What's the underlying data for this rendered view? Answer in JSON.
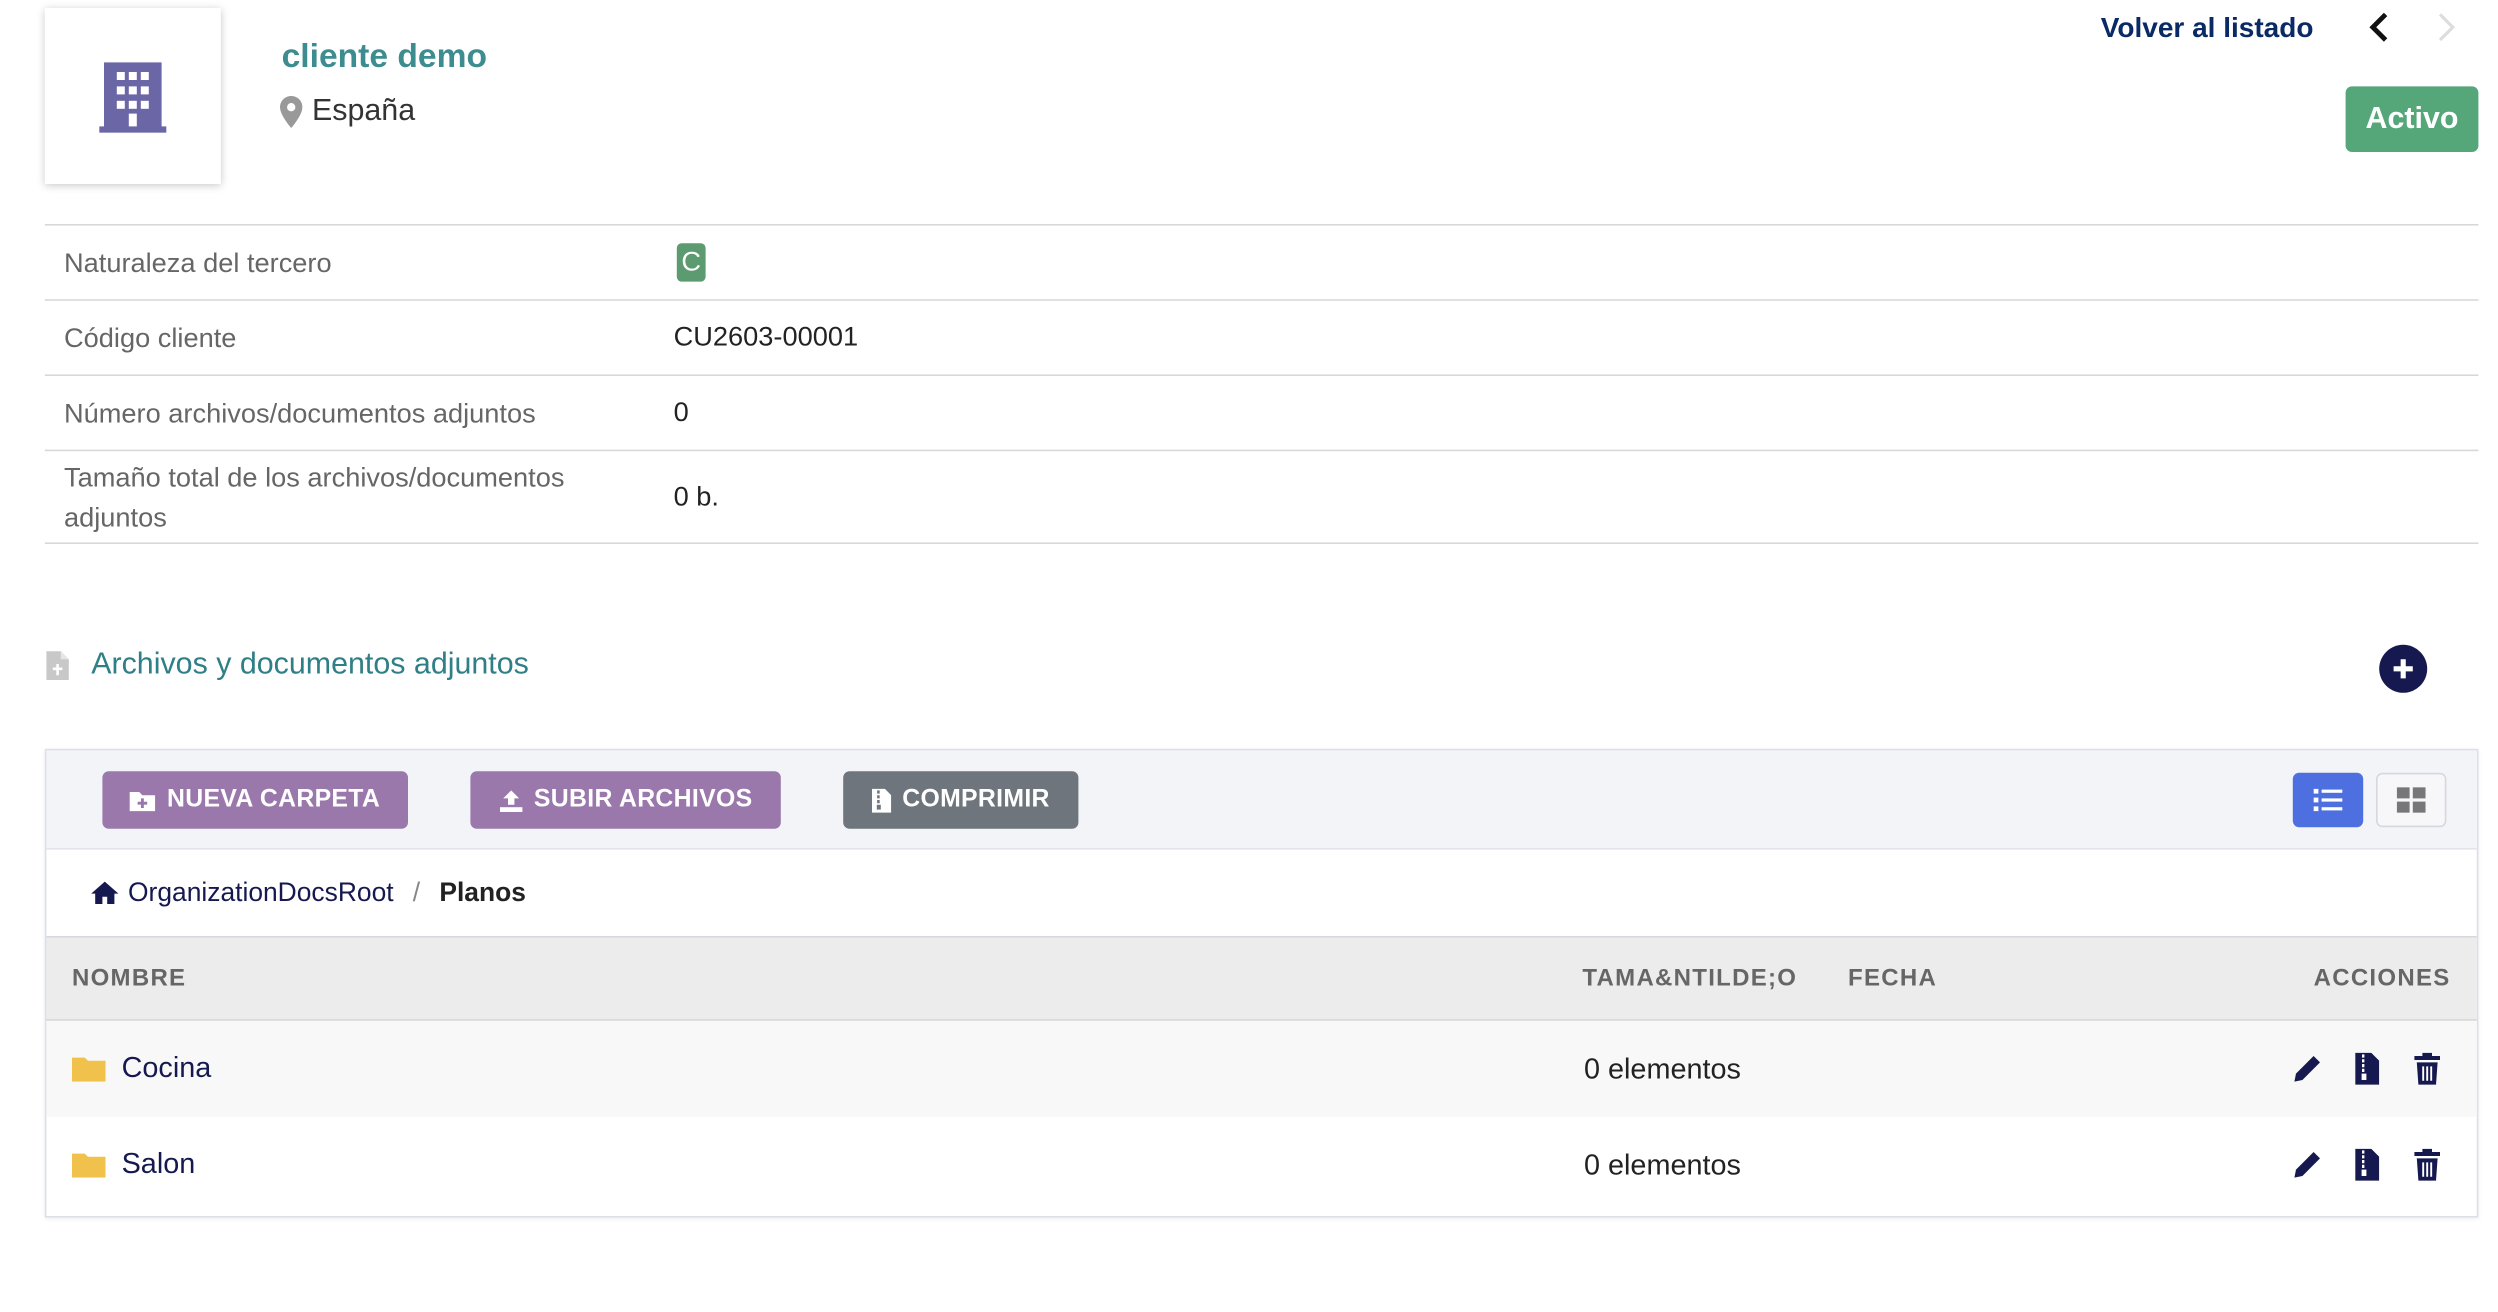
{
  "header": {
    "company_name": "cliente demo",
    "country": "España",
    "back_label": "Volver al listado",
    "status": "Activo"
  },
  "info_rows": [
    {
      "label": "Naturaleza del tercero",
      "value": "C"
    },
    {
      "label": "Código cliente",
      "value": "CU2603-00001"
    },
    {
      "label": "Número archivos/documentos adjuntos",
      "value": "0"
    },
    {
      "label": "Tamaño total de los archivos/documentos adjuntos",
      "value": "0 b."
    }
  ],
  "attachments": {
    "title": "Archivos y documentos adjuntos",
    "toolbar": {
      "new_folder": "NUEVA CARPETA",
      "upload": "SUBIR ARCHIVOS",
      "compress": "COMPRIMIR"
    },
    "breadcrumb": {
      "root": "OrganizationDocsRoot",
      "separator": "/",
      "current": "Planos"
    },
    "columns": {
      "name": "NOMBRE",
      "size": "TAMA&NTILDE;O",
      "date": "FECHA",
      "actions": "ACCIONES"
    },
    "rows": [
      {
        "name": "Cocina",
        "size": "0 elementos"
      },
      {
        "name": "Salon",
        "size": "0 elementos"
      }
    ]
  },
  "colors": {
    "accent_teal": "#3d8c8f",
    "status_green": "#55a77a",
    "navy": "#16194f",
    "purple_button": "#9a78ab",
    "gray_button": "#6e757c",
    "view_active": "#4e6fe0",
    "folder": "#f0c24b"
  },
  "icons": [
    "building-icon",
    "map-pin-icon",
    "chevron-left-icon",
    "chevron-right-icon",
    "file-icon",
    "plus-circle-icon",
    "folder-plus-icon",
    "upload-icon",
    "file-zip-icon",
    "list-view-icon",
    "grid-view-icon",
    "home-icon",
    "folder-icon",
    "pencil-icon",
    "trash-icon"
  ]
}
